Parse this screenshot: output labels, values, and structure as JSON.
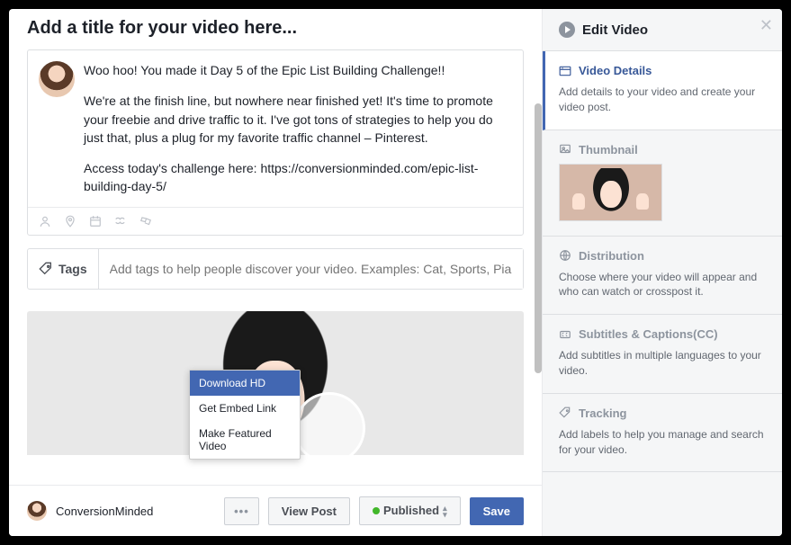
{
  "header": {
    "title": "Add a title for your video here..."
  },
  "composer": {
    "p1": "Woo hoo! You made it Day 5 of the Epic List Building Challenge!!",
    "p2": "We're at the finish line, but nowhere near finished yet! It's time to promote your freebie and drive traffic to it. I've got tons of strategies to help you do just that, plus a plug for my favorite traffic channel – Pinterest.",
    "p3": "Access today's challenge here: https://conversionminded.com/epic-list-building-day-5/"
  },
  "tags": {
    "label": "Tags",
    "placeholder": "Add tags to help people discover your video. Examples: Cat, Sports, Piano"
  },
  "dropdown": {
    "download": "Download HD",
    "embed": "Get Embed Link",
    "featured": "Make Featured Video"
  },
  "footer": {
    "page_name": "ConversionMinded",
    "view_post": "View Post",
    "published": "Published",
    "save": "Save"
  },
  "sidebar": {
    "title": "Edit Video",
    "sections": {
      "video_details": {
        "title": "Video Details",
        "desc": "Add details to your video and create your video post."
      },
      "thumbnail": {
        "title": "Thumbnail"
      },
      "distribution": {
        "title": "Distribution",
        "desc": "Choose where your video will appear and who can watch or crosspost it."
      },
      "subtitles": {
        "title": "Subtitles & Captions(CC)",
        "desc": "Add subtitles in multiple languages to your video."
      },
      "tracking": {
        "title": "Tracking",
        "desc": "Add labels to help you manage and search for your video."
      }
    }
  }
}
